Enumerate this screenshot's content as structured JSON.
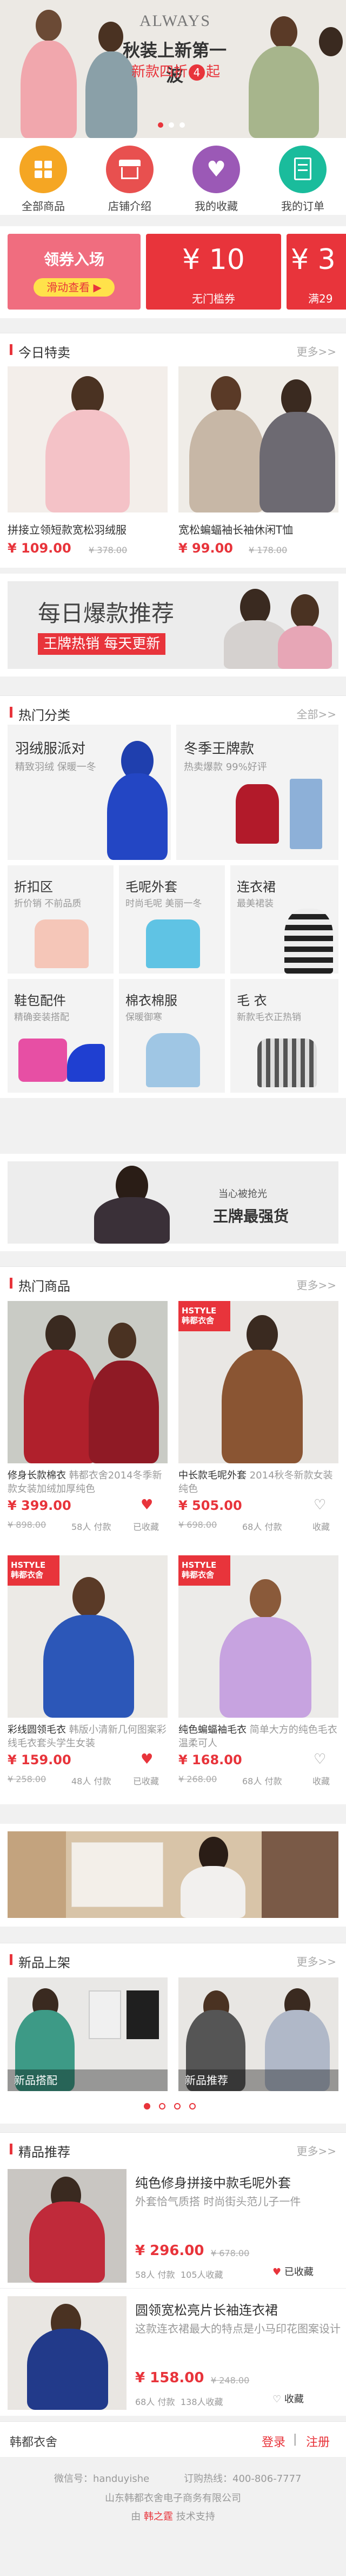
{
  "banner": {
    "brand": "ALWAYS",
    "line1": "秋装上新第一波",
    "line2_a": "新款四折",
    "line2_b": "起"
  },
  "nav": [
    {
      "label": "全部商品",
      "icon": "grid-icon",
      "color": "#f39c12"
    },
    {
      "label": "店铺介绍",
      "icon": "store-icon",
      "color": "#e74c3c"
    },
    {
      "label": "我的收藏",
      "icon": "heart-icon",
      "color": "#9b59b6"
    },
    {
      "label": "我的订单",
      "icon": "order-icon",
      "color": "#1abc9c"
    }
  ],
  "coupons": {
    "receive_title": "领券入场",
    "receive_action": "滑动查看 ▶",
    "c1_amount": "¥ 10",
    "c1_label": "无门槛券",
    "c2_amount": "¥ 3",
    "c2_label": "满29"
  },
  "today": {
    "title": "今日特卖",
    "more": "更多>>",
    "items": [
      {
        "name": "拼接立领短款宽松羽绒服",
        "price": "¥ 109.00",
        "old": "¥ 378.00"
      },
      {
        "name": "宽松蝙蝠袖长袖休闲T恤",
        "price": "¥ 99.00",
        "old": "¥ 178.00"
      }
    ]
  },
  "daily_banner": {
    "title": "每日爆款推荐",
    "subtitle": "王牌热销 每天更新"
  },
  "categories": {
    "title": "热门分类",
    "more": "全部>>",
    "big1": {
      "name": "羽绒服派对",
      "desc": "精致羽绒 保暖一冬"
    },
    "big2": {
      "name": "冬季王牌款",
      "desc": "热卖爆款 99%好评"
    },
    "small": [
      {
        "name": "折扣区",
        "desc": "折价销 不前品质"
      },
      {
        "name": "毛呢外套",
        "desc": "时尚毛呢 美丽一冬"
      },
      {
        "name": "连衣裙",
        "desc": "最美裙装"
      },
      {
        "name": "鞋包配件",
        "desc": "精确妾装搭配"
      },
      {
        "name": "棉衣棉服",
        "desc": "保暖御寒"
      },
      {
        "name": "毛 衣",
        "desc": "新款毛衣正热销"
      }
    ]
  },
  "ad_banner": {
    "small": "当心被抢光",
    "big": "王牌最强货"
  },
  "hot": {
    "title": "热门商品",
    "more": "更多>>",
    "items": [
      {
        "tag": "",
        "name": "修身长款棉衣",
        "name2": "韩都衣舍2014冬季新款女装加绒加厚纯色",
        "price": "¥ 399.00",
        "old": "¥ 898.00",
        "sold": "58人 付款",
        "fav": "已收藏"
      },
      {
        "tag": "HSTYLE 韩都衣舍",
        "name": "中长款毛呢外套",
        "name2": "2014秋冬新款女装纯色",
        "price": "¥ 505.00",
        "old": "¥ 698.00",
        "sold": "68人 付款",
        "fav": "收藏"
      },
      {
        "tag": "HSTYLE 韩都衣舍",
        "name": "彩线圆领毛衣",
        "name2": "韩版小清新几何图案彩线毛衣套头学生女装",
        "price": "¥ 159.00",
        "old": "¥ 258.00",
        "sold": "48人 付款",
        "fav": "已收藏"
      },
      {
        "tag": "HSTYLE 韩都衣舍",
        "name": "纯色蝙蝠袖毛衣",
        "name2": "简单大方的纯色毛衣温柔可人",
        "price": "¥ 168.00",
        "old": "¥ 268.00",
        "sold": "68人 付款",
        "fav": "收藏"
      }
    ]
  },
  "new": {
    "title": "新品上架",
    "more": "更多>>",
    "labels": [
      "新品搭配",
      "新品推荐"
    ]
  },
  "fine": {
    "title": "精品推荐",
    "more": "更多>>",
    "items": [
      {
        "name": "纯色修身拼接中款毛呢外套",
        "desc": "外套恰气质搭 时尚街头范儿子一件",
        "price": "¥ 296.00",
        "old": "¥ 678.00",
        "sold": "58人 付款",
        "fav": "105人收藏",
        "fav_btn": "已收藏"
      },
      {
        "name": "圆领宽松亮片长袖连衣裙",
        "desc": "这款连衣裙最大的特点是小马印花图案设计",
        "price": "¥ 158.00",
        "old": "¥ 248.00",
        "sold": "68人 付款",
        "fav": "138人收藏",
        "fav_btn": "收藏"
      }
    ]
  },
  "footer": {
    "shop": "韩都衣舍",
    "login": "登录",
    "sep": "|",
    "register": "注册",
    "wechat": "微信号：handuyishe",
    "hotline": "订购热线：400-806-7777",
    "company": "山东韩都衣舍电子商务有限公司",
    "support_prefix": "由",
    "support_brand": "韩之霆",
    "support_suffix": "技术支持"
  },
  "colors": {
    "accent": "#e8343b",
    "pink": "#f06d7f"
  }
}
